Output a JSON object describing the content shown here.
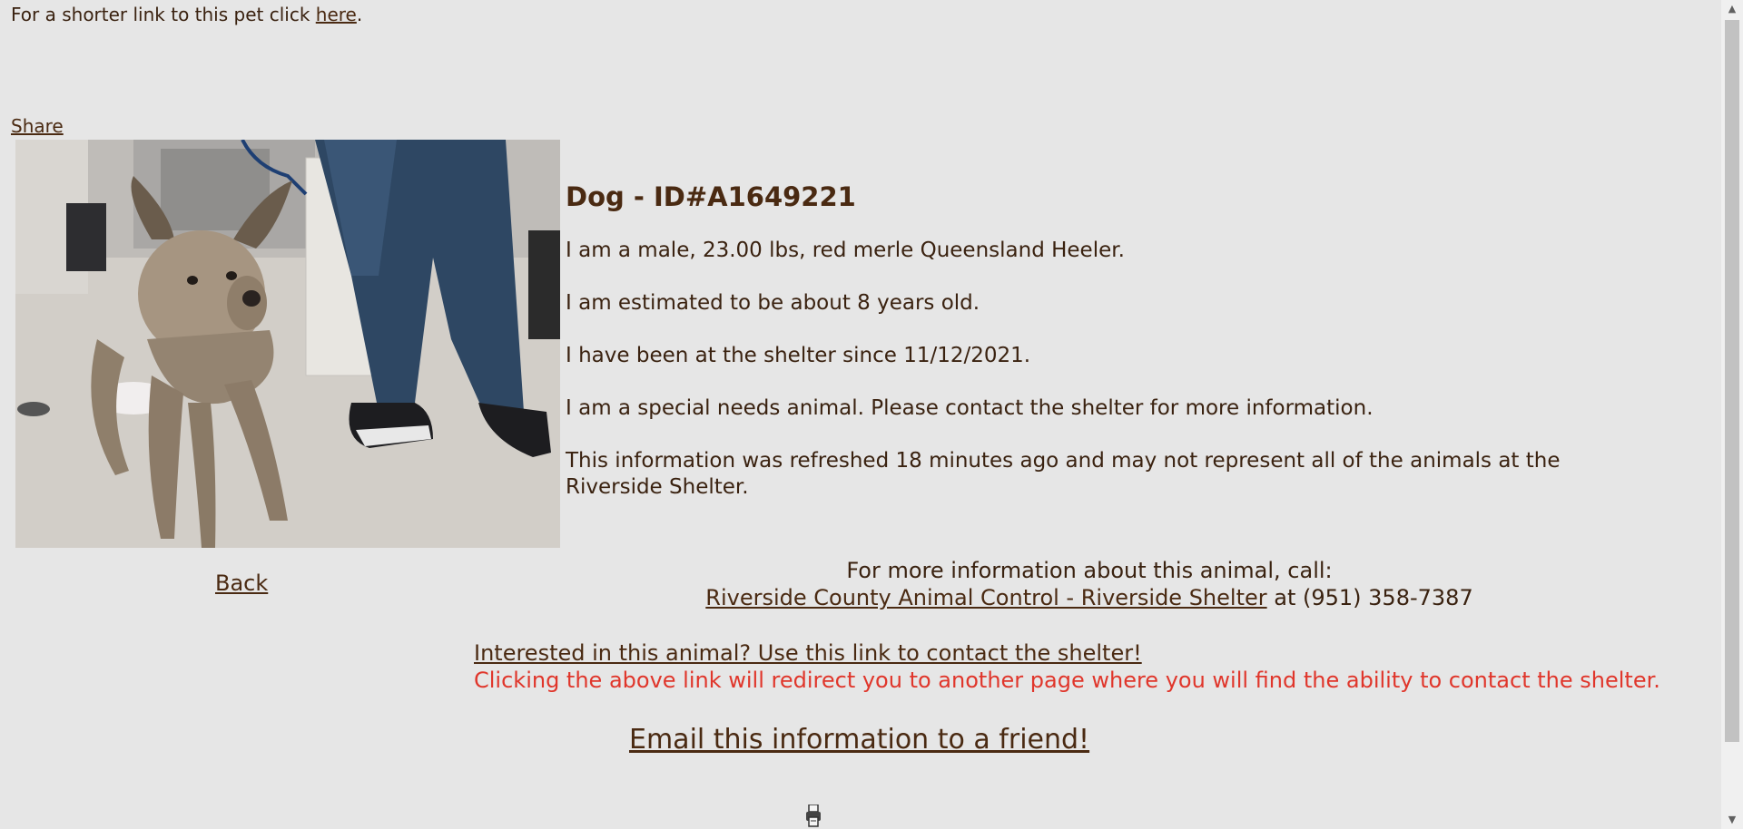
{
  "top": {
    "short_link_prefix": "For a shorter link to this pet click ",
    "short_link_label": "here",
    "short_link_suffix": "."
  },
  "share_label": "Share",
  "photo": {
    "alt": "Photo of Dog ID#A1649221"
  },
  "back_label": "Back",
  "animal": {
    "title": "Dog - ID#A1649221",
    "description": "I am a male, 23.00 lbs, red merle Queensland Heeler.",
    "age": "I am estimated to be about 8 years old.",
    "since": "I have been at the shelter since 11/12/2021.",
    "special_needs": "I am a special needs animal. Please contact the shelter for more information.",
    "refresh_note": "This information was refreshed 18 minutes ago and may not represent all of the animals at the Riverside Shelter."
  },
  "contact": {
    "call_text": "For more information about this animal, call:",
    "shelter_link": "Riverside County Animal Control - Riverside Shelter",
    "phone_text": " at (951) 358-7387"
  },
  "interest": {
    "link_label": "Interested in this animal? Use this link to contact the shelter!",
    "note": "Clicking the above link will redirect you to another page where you will find the ability to contact the shelter."
  },
  "email_label": "Email this information to a friend!",
  "icons": {
    "print": "print-icon",
    "scroll_up": "scroll-up-arrow-icon",
    "scroll_down": "scroll-down-arrow-icon"
  },
  "colors": {
    "background": "#e6e6e6",
    "text_brown": "#4a2a12",
    "note_red": "#e0362b"
  }
}
